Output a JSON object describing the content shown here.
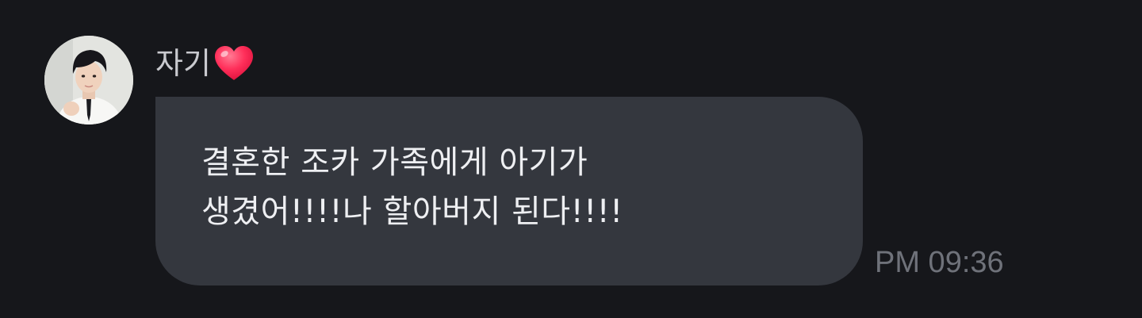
{
  "message": {
    "sender_name": "자기",
    "sender_emoji_icon": "red-heart-icon",
    "avatar_icon": "profile-photo-avatar",
    "text_lines": [
      "결혼한 조카 가족에게 아기가",
      "생겼어!!!!나 할아버지 된다!!!!"
    ],
    "timestamp": "PM 09:36"
  },
  "colors": {
    "background": "#16171b",
    "bubble": "#34373e",
    "message_text": "#eeeff2",
    "sender_text": "#c9cacf",
    "timestamp_text": "#6f727a",
    "heart": "#ff2f5a"
  }
}
